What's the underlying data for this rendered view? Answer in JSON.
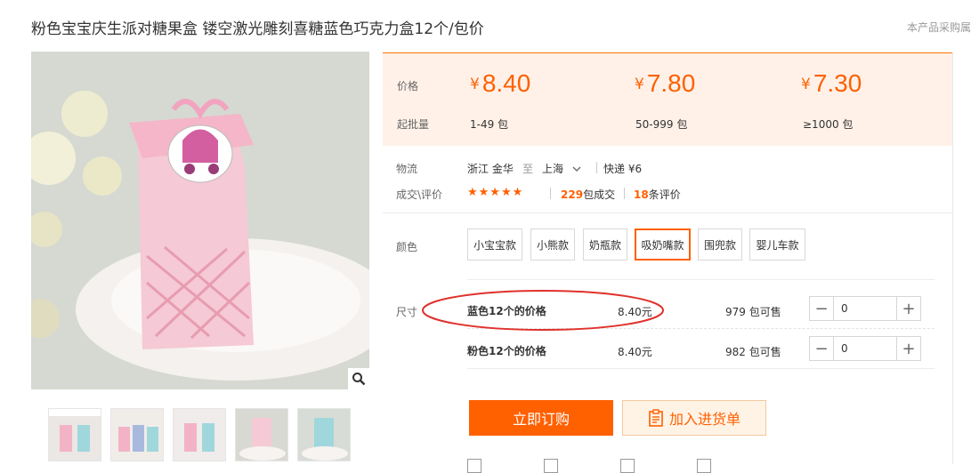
{
  "title": "粉色宝宝庆生派对糖果盒 镂空激光雕刻喜糖蓝色巧克力盒12个/包价",
  "top_right_note": "本产品采购属",
  "price_panel": {
    "price_label": "价格",
    "moq_label": "起批量",
    "currency": "¥",
    "tiers": [
      {
        "price": "8.40",
        "moq": "1-49 包"
      },
      {
        "price": "7.80",
        "moq": "50-999 包"
      },
      {
        "price": "7.30",
        "moq": "≥1000 包"
      }
    ]
  },
  "logistics": {
    "label": "物流",
    "origin": "浙江 金华",
    "to": "至",
    "destination": "上海",
    "shipping": "快递 ¥6"
  },
  "deals": {
    "label": "成交\\评价",
    "stars": "★★★★★",
    "deal_count": "229",
    "deal_suffix": "包成交",
    "review_count": "18",
    "review_suffix": "条评价"
  },
  "colors": {
    "label": "颜色",
    "options": [
      "小宝宝款",
      "小熊款",
      "奶瓶款",
      "吸奶嘴款",
      "围兜款",
      "婴儿车款"
    ],
    "selected": "吸奶嘴款"
  },
  "sizes": {
    "label": "尺寸",
    "rows": [
      {
        "name": "蓝色12个的价格",
        "price": "8.40元",
        "stock": "979 包可售",
        "qty": "0"
      },
      {
        "name": "粉色12个的价格",
        "price": "8.40元",
        "stock": "982 包可售",
        "qty": "0"
      }
    ]
  },
  "actions": {
    "order": "立即订购",
    "add_to_list": "加入进货单"
  },
  "colors_theme": {
    "accent": "#ff6000",
    "panel_bg": "#fff1e8",
    "annotation": "#e0312b"
  }
}
